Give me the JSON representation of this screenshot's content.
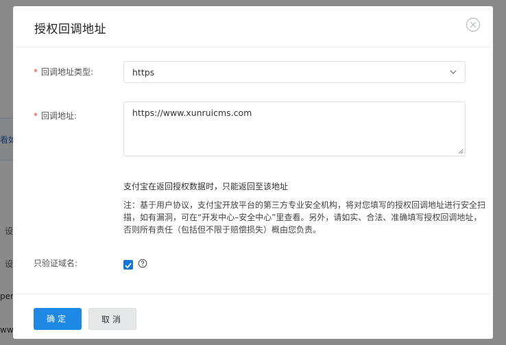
{
  "background": {
    "fragments": [
      "看如",
      "设",
      "设",
      "pena",
      "ww."
    ]
  },
  "dialog": {
    "title": "授权回调地址",
    "close_icon": "close-circle-icon"
  },
  "form": {
    "required_mark": "*",
    "callback_type": {
      "label": "回调地址类型:",
      "value": "https"
    },
    "callback_url": {
      "label": "回调地址:",
      "value": "https://www.xunruicms.com"
    },
    "hint": "支付宝在返回授权数据时，只能返回至该地址",
    "notice": "注：基于用户协议，支付宝开放平台的第三方专业安全机构，将对您填写的授权回调地址进行安全扫描，如有漏洞，可在“开发中心–安全中心”里查看。另外，请如实、合法、准确填写授权回调地址，否则所有责任（包括但不限于赔偿损失）概由您负责。",
    "verify_domain": {
      "label": "只验证域名:",
      "checked": true
    }
  },
  "footer": {
    "confirm_label": "确定",
    "cancel_label": "取消"
  },
  "colors": {
    "primary": "#1e88e5",
    "required": "#e5392f",
    "checkbox": "#1976d2"
  }
}
